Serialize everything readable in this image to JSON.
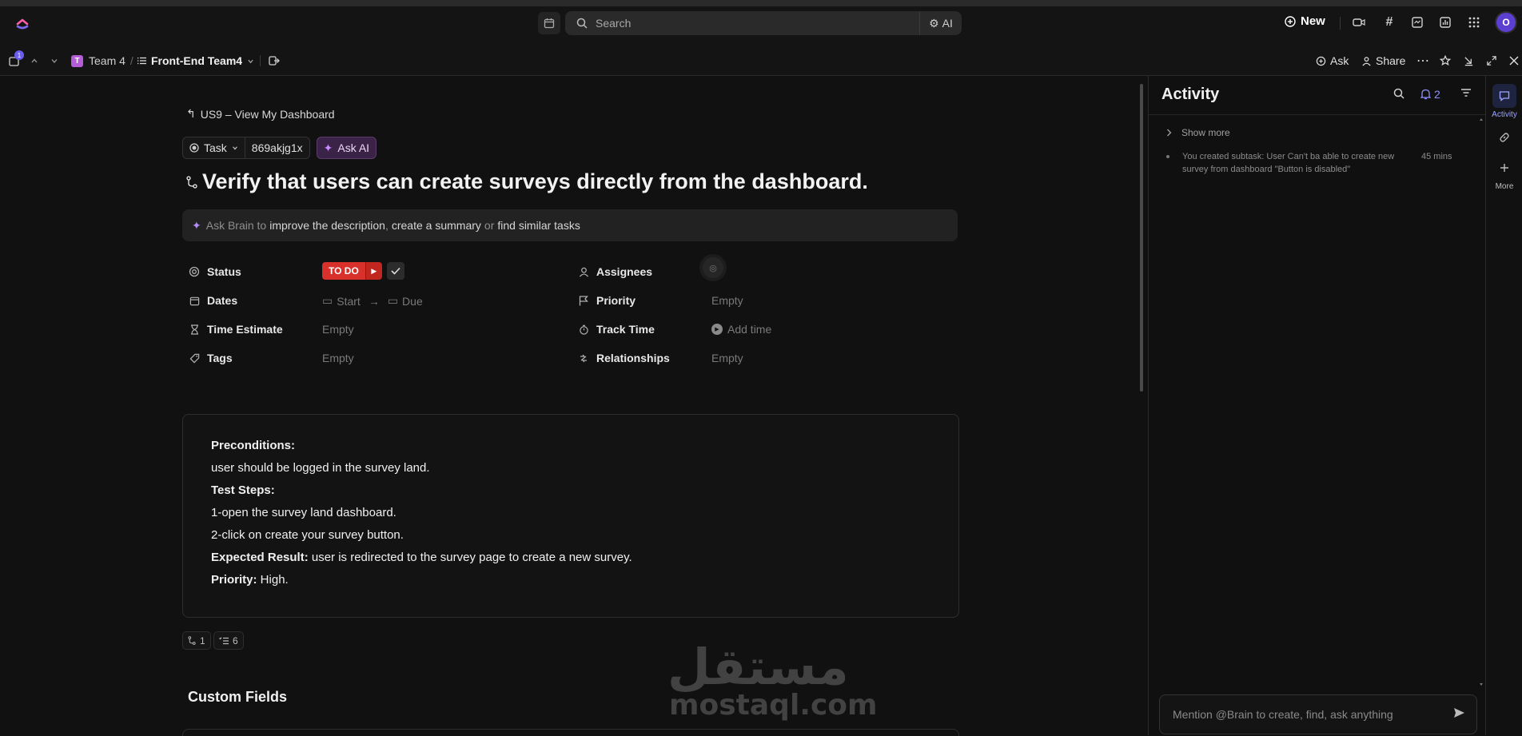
{
  "topbar": {
    "search_placeholder": "Search",
    "ai_label": "AI",
    "new_label": "New",
    "avatar_initial": "O"
  },
  "breadcrumb": {
    "notification_count": "1",
    "team_badge": "T",
    "team": "Team 4",
    "separator": "/",
    "list": "Front-End Team4",
    "ask_label": "Ask",
    "share_label": "Share"
  },
  "task": {
    "parent_link": "US9 – View My Dashboard",
    "type_label": "Task",
    "task_id": "869akjg1x",
    "ask_ai_label": "Ask AI",
    "title": "Verify that users can create surveys directly from the dashboard.",
    "brain_bar": {
      "prefix": "Ask Brain to",
      "link1": "improve the description",
      "sep1": ",",
      "link2": "create a summary",
      "or": "or",
      "link3": "find similar tasks"
    }
  },
  "fields": {
    "status": {
      "label": "Status",
      "value": "TO DO"
    },
    "dates": {
      "label": "Dates",
      "start": "Start",
      "arrow": "→",
      "due": "Due"
    },
    "time_estimate": {
      "label": "Time Estimate",
      "value": "Empty"
    },
    "tags": {
      "label": "Tags",
      "value": "Empty"
    },
    "assignees": {
      "label": "Assignees"
    },
    "priority": {
      "label": "Priority",
      "value": "Empty"
    },
    "track_time": {
      "label": "Track Time",
      "value": "Add time"
    },
    "relationships": {
      "label": "Relationships",
      "value": "Empty"
    }
  },
  "description": {
    "preconditions_label": "Preconditions:",
    "preconditions_text": "user should be logged in the survey land.",
    "test_steps_label": "Test Steps:",
    "step1": "1-open the survey land dashboard.",
    "step2": "2-click on create your survey button.",
    "expected_label": "Expected Result:",
    "expected_text": " user is redirected to the survey page to create a new survey.",
    "priority_label": "Priority:",
    "priority_text": " High."
  },
  "subtask_counts": {
    "subtasks": "1",
    "checklists": "6"
  },
  "custom_fields_heading": "Custom Fields",
  "watermark": {
    "arabic": "مستقل",
    "latin": "mostaql.com"
  },
  "activity": {
    "title": "Activity",
    "notification_count": "2",
    "show_more": "Show more",
    "entries": [
      {
        "text": "You created subtask: User Can't ba able to create new survey from dashboard \"Button is disabled\"",
        "time": "45 mins"
      }
    ],
    "comment_placeholder": "Mention @Brain to create, find, ask anything"
  },
  "rail": {
    "activity_label": "Activity",
    "more_label": "More"
  },
  "colors": {
    "accent": "#7b68ee",
    "status_todo": "#d8302a",
    "background": "#111111"
  }
}
